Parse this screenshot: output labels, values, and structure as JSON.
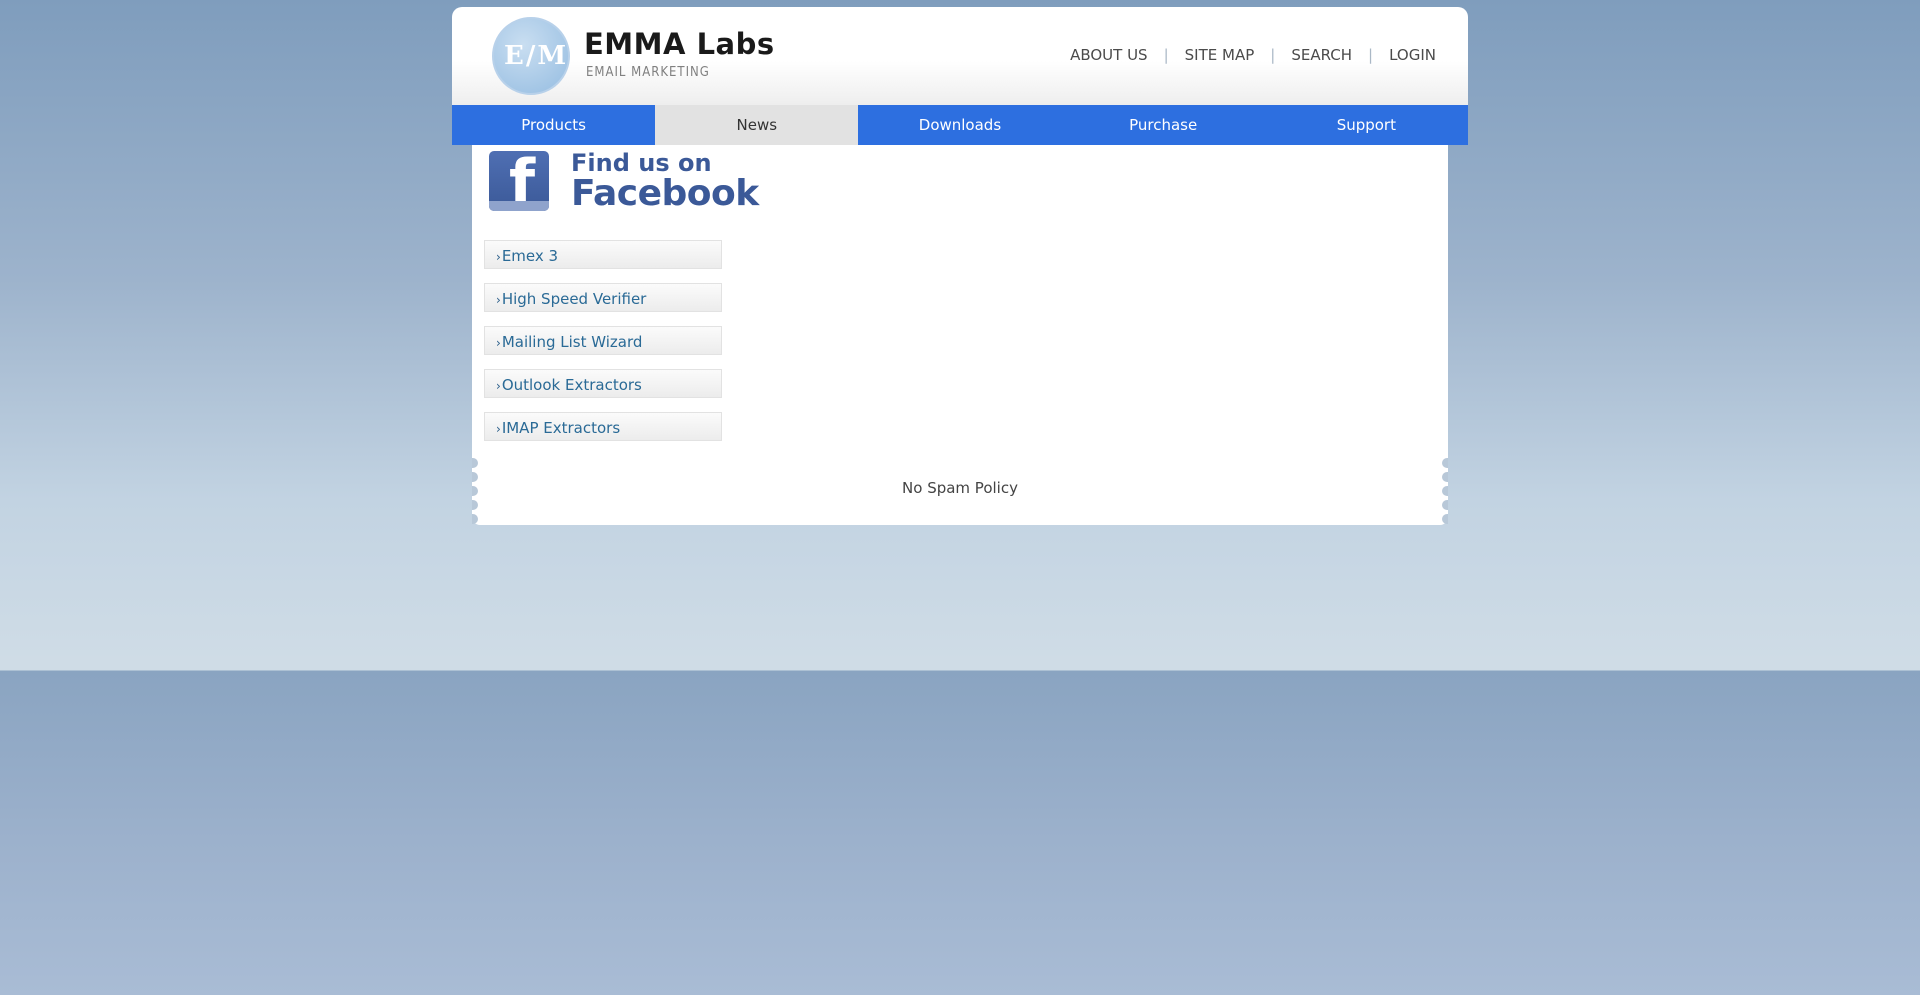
{
  "brand": {
    "letters": "E/M",
    "name": "EMMA Labs",
    "tagline": "EMAIL MARKETING"
  },
  "top_nav": [
    {
      "label": "ABOUT US"
    },
    {
      "label": "SITE MAP"
    },
    {
      "label": "SEARCH"
    },
    {
      "label": "LOGIN"
    }
  ],
  "main_nav": [
    {
      "label": "Products",
      "active": false
    },
    {
      "label": "News",
      "active": true
    },
    {
      "label": "Downloads",
      "active": false
    },
    {
      "label": "Purchase",
      "active": false
    },
    {
      "label": "Support",
      "active": false
    }
  ],
  "facebook": {
    "line1": "Find us on",
    "line2": "Facebook",
    "icon": "facebook-f-icon"
  },
  "products": [
    {
      "label": "Emex 3"
    },
    {
      "label": "High Speed Verifier"
    },
    {
      "label": "Mailing List Wizard"
    },
    {
      "label": "Outlook Extractors"
    },
    {
      "label": "IMAP Extractors"
    }
  ],
  "footer": {
    "link": "No Spam Policy"
  },
  "colors": {
    "nav_blue": "#2d6fe0",
    "nav_active": "#e2e2e2",
    "link_blue": "#2a6a96",
    "facebook_blue": "#3b5998"
  }
}
